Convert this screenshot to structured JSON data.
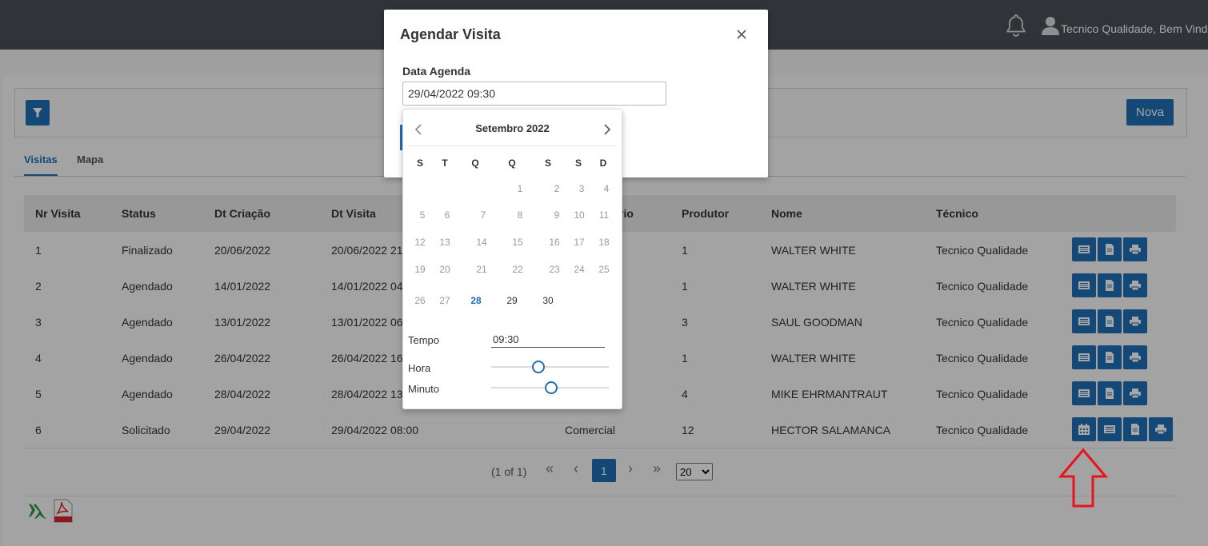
{
  "header": {
    "greeting": "Tecnico Qualidade, Bem Vindo"
  },
  "toolbar": {
    "nova_label": "Nova"
  },
  "tabs": [
    {
      "label": "Visitas"
    },
    {
      "label": "Mapa"
    }
  ],
  "table": {
    "columns": [
      "Nr Visita",
      "Status",
      "Dt Criação",
      "Dt Visita",
      "rio",
      "Produtor",
      "Nome",
      "Técnico"
    ],
    "rows": [
      {
        "nr": "1",
        "status": "Finalizado",
        "criacao": "20/06/2022",
        "visita": "20/06/2022 21:",
        "tipo": "",
        "produtor": "1",
        "nome": "WALTER WHITE",
        "tecnico": "Tecnico Qualidade"
      },
      {
        "nr": "2",
        "status": "Agendado",
        "criacao": "14/01/2022",
        "visita": "14/01/2022 04:",
        "tipo": "",
        "produtor": "1",
        "nome": "WALTER WHITE",
        "tecnico": "Tecnico Qualidade"
      },
      {
        "nr": "3",
        "status": "Agendado",
        "criacao": "13/01/2022",
        "visita": "13/01/2022 06:",
        "tipo": "",
        "produtor": "3",
        "nome": "SAUL GOODMAN",
        "tecnico": "Tecnico Qualidade"
      },
      {
        "nr": "4",
        "status": "Agendado",
        "criacao": "26/04/2022",
        "visita": "26/04/2022 16:",
        "tipo": "",
        "produtor": "1",
        "nome": "WALTER WHITE",
        "tecnico": "Tecnico Qualidade"
      },
      {
        "nr": "5",
        "status": "Agendado",
        "criacao": "28/04/2022",
        "visita": "28/04/2022 13:",
        "tipo": "",
        "produtor": "4",
        "nome": "MIKE EHRMANTRAUT",
        "tecnico": "Tecnico Qualidade"
      },
      {
        "nr": "6",
        "status": "Solicitado",
        "criacao": "29/04/2022",
        "visita": "29/04/2022 08:00",
        "tipo": "Comercial",
        "produtor": "12",
        "nome": "HECTOR SALAMANCA",
        "tecnico": "Tecnico Qualidade"
      }
    ]
  },
  "pagination": {
    "summary": "(1 of 1)",
    "first": "«",
    "prev": "‹",
    "current": "1",
    "next": "›",
    "last": "»",
    "page_size": "20",
    "page_size_options": [
      "20"
    ]
  },
  "dialog": {
    "title": "Agendar Visita",
    "close": "×",
    "field_label": "Data Agenda",
    "field_value": "29/04/2022 09:30"
  },
  "datepicker": {
    "month_label": "Setembro 2022",
    "weekdays": [
      "S",
      "T",
      "Q",
      "Q",
      "S",
      "S",
      "D"
    ],
    "weeks": [
      [
        "",
        "",
        "",
        "1",
        "2",
        "3",
        "4"
      ],
      [
        "5",
        "6",
        "7",
        "8",
        "9",
        "10",
        "11"
      ],
      [
        "12",
        "13",
        "14",
        "15",
        "16",
        "17",
        "18"
      ],
      [
        "19",
        "20",
        "21",
        "22",
        "23",
        "24",
        "25"
      ],
      [
        "26",
        "27",
        "28",
        "29",
        "30",
        "",
        ""
      ]
    ],
    "today": "28",
    "time_label": "Tempo",
    "time_value": "09:30",
    "hour_label": "Hora",
    "minute_label": "Minuto",
    "hour_value": 9,
    "minute_value": 30
  },
  "colors": {
    "accent": "#1f6fb5",
    "topbar": "#4a5058",
    "annotation_arrow": "#e8141c"
  }
}
